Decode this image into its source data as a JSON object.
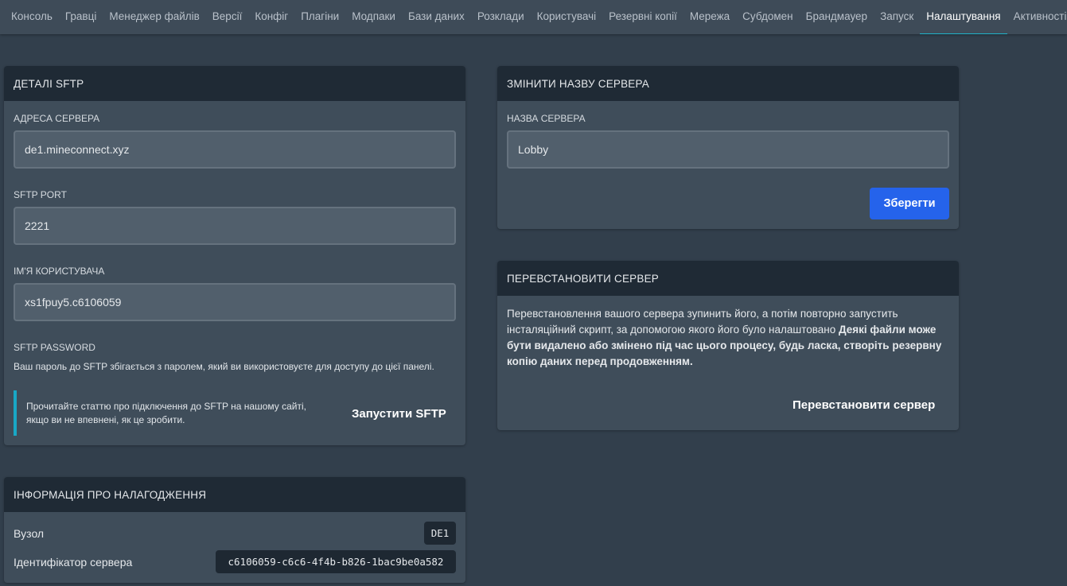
{
  "nav": {
    "tabs": [
      "Консоль",
      "Гравці",
      "Менеджер файлів",
      "Версії",
      "Конфіг",
      "Плагіни",
      "Модпаки",
      "Бази даних",
      "Розклади",
      "Користувачі",
      "Резервні копії",
      "Мережа",
      "Субдомен",
      "Брандмауер",
      "Запуск",
      "Налаштування",
      "Активності"
    ],
    "active": "Налаштування"
  },
  "sftp": {
    "title": "ДЕТАЛІ SFTP",
    "address_label": "АДРЕСА СЕРВЕРА",
    "address_value": "de1.mineconnect.xyz",
    "port_label": "SFTP PORT",
    "port_value": "2221",
    "user_label": "ІМ'Я КОРИСТУВАЧА",
    "user_value": "xs1fpuy5.c6106059",
    "password_label": "SFTP PASSWORD",
    "password_help": "Ваш пароль до SFTP збігається з паролем, який ви використовуєте для доступу до цієї панелі.",
    "callout": "Прочитайте статтю про підключення до SFTP на нашому сайті, якщо ви не впевнені, як це зробити.",
    "launch_button": "Запустити SFTP"
  },
  "debug": {
    "title": "ІНФОРМАЦІЯ ПРО НАЛАГОДЖЕННЯ",
    "node_label": "Вузол",
    "node_value": "DE1",
    "server_id_label": "Ідентифікатор сервера",
    "server_id_value": "c6106059-c6c6-4f4b-b826-1bac9be0a582"
  },
  "rename": {
    "title": "ЗМІНИТИ НАЗВУ СЕРВЕРА",
    "name_label": "НАЗВА СЕРВЕРА",
    "name_value": "Lobby",
    "save_button": "Зберегти"
  },
  "reinstall": {
    "title": "ПЕРЕВСТАНОВИТИ СЕРВЕР",
    "text_normal": "Перевстановлення вашого сервера зупинить його, а потім повторно запустить інсталяційний скрипт, за допомогою якого його було налаштовано ",
    "text_bold": "Деякі файли може бути видалено або змінено під час цього процесу, будь ласка, створіть резервну копію даних перед продовженням.",
    "button": "Перевстановити сервер"
  },
  "colors": {
    "background": "#323f4c",
    "card": "#3f4d5a",
    "card_header": "#1f2a35",
    "accent": "#1fb3c9",
    "primary": "#2563eb"
  }
}
